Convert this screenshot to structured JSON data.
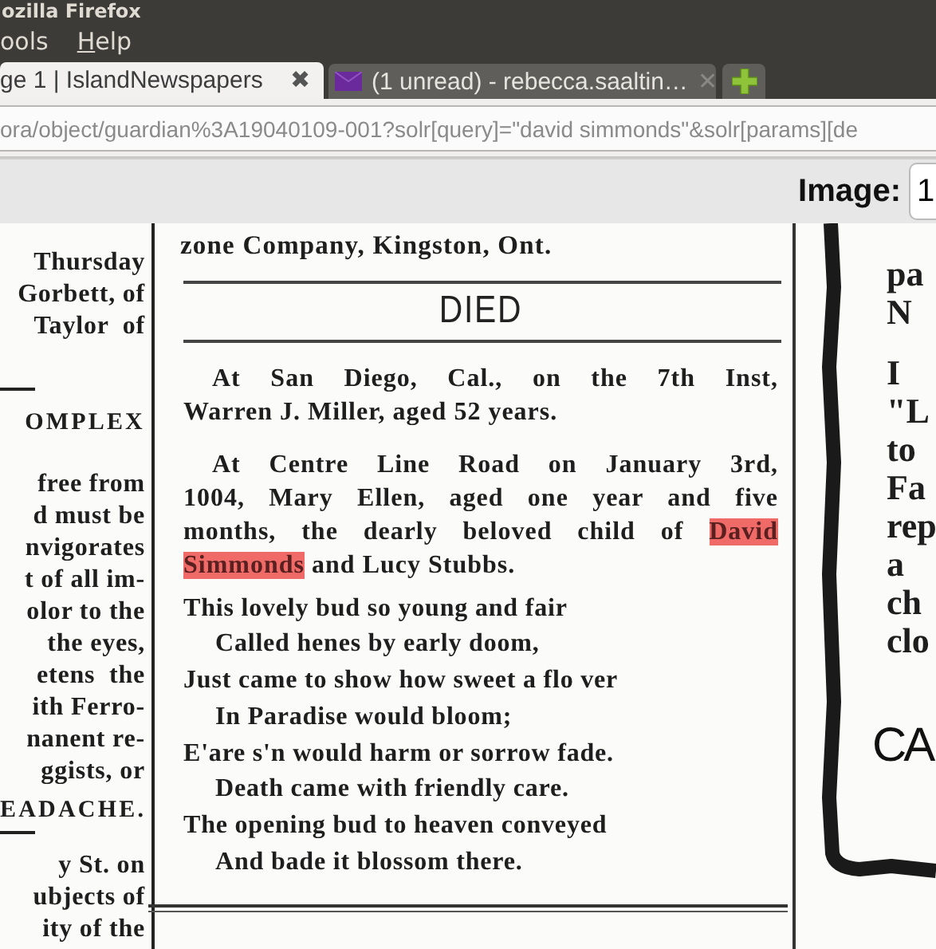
{
  "window": {
    "title": "ozilla Firefox"
  },
  "menu": [
    {
      "label": "ools",
      "underline_first": false
    },
    {
      "label": "Help",
      "underline_first": true
    }
  ],
  "tabs": [
    {
      "label": "ge 1 | IslandNewspapers",
      "selected": true,
      "kind": "page",
      "close": "✖"
    },
    {
      "label": "(1 unread) - rebecca.saaltin…",
      "selected": false,
      "kind": "mail",
      "close": "✕"
    }
  ],
  "address_bar": {
    "value": "ora/object/guardian%3A19040109-001?solr[query]=\"david simmonds\"&solr[params][de"
  },
  "viewer_toolbar": {
    "label": "Image:",
    "value": "1"
  },
  "newspaper": {
    "left_column": [
      {
        "kind": "line",
        "text": "Thursday"
      },
      {
        "kind": "line",
        "text": "Gorbett, of"
      },
      {
        "kind": "line",
        "text": "Taylor  of"
      },
      {
        "kind": "rule"
      },
      {
        "kind": "heading",
        "text": "OMPLEX"
      },
      {
        "kind": "gap_line",
        "text": "free from"
      },
      {
        "kind": "line",
        "text": "d must be"
      },
      {
        "kind": "line",
        "text": "nvigorates"
      },
      {
        "kind": "line",
        "text": "t of all im-"
      },
      {
        "kind": "line",
        "text": "olor to the"
      },
      {
        "kind": "line",
        "text": "the eyes,"
      },
      {
        "kind": "line",
        "text": "etens  the"
      },
      {
        "kind": "line",
        "text": "ith Ferro-"
      },
      {
        "kind": "line",
        "text": "nanent re-"
      },
      {
        "kind": "line",
        "text": "ggists, or"
      },
      {
        "kind": "heading",
        "text": "EADACHE."
      },
      {
        "kind": "rule"
      },
      {
        "kind": "line",
        "text": "y St. on"
      },
      {
        "kind": "line",
        "text": "ubjects of"
      },
      {
        "kind": "line",
        "text": "ity of the"
      }
    ],
    "middle_column": {
      "top_line": "zone Company, Kingston, Ont.",
      "heading": "DIED",
      "paragraphs": [
        {
          "lines": [
            [
              {
                "text": "At San Diego, Cal., on the 7th Inst,",
                "highlighted": false
              }
            ],
            [
              {
                "text": "Warren J. Miller, aged 52 years.",
                "highlighted": false
              }
            ]
          ]
        },
        {
          "lines": [
            [
              {
                "text": "At Centre Line Road on January 3rd,",
                "highlighted": false
              }
            ],
            [
              {
                "text": "1004, Mary Ellen, aged one year and five",
                "highlighted": false
              }
            ],
            [
              {
                "text": "months, the dearly beloved child of ",
                "highlighted": false
              },
              {
                "text": "David",
                "highlighted": true
              }
            ],
            [
              {
                "text": "Simmonds",
                "highlighted": true
              },
              {
                "text": " and Lucy Stubbs.",
                "highlighted": false
              }
            ]
          ]
        }
      ],
      "poem": [
        {
          "text": "This lovely bud so young and fair",
          "indented": false
        },
        {
          "text": "Called henes by early doom,",
          "indented": true
        },
        {
          "text": "Just came to show how sweet a flo ver",
          "indented": false
        },
        {
          "text": "In Paradise would bloom;",
          "indented": true
        },
        {
          "text": "E'are s'n would harm or sorrow fade.",
          "indented": false
        },
        {
          "text": "Death came with friendly care.",
          "indented": true
        },
        {
          "text": "The opening bud to heaven conveyed",
          "indented": false
        },
        {
          "text": "And bade it blossom there.",
          "indented": true
        }
      ]
    },
    "right_column": [
      {
        "kind": "line",
        "text": "pa"
      },
      {
        "kind": "line",
        "text": "N"
      },
      {
        "kind": "gap_line",
        "text": "I"
      },
      {
        "kind": "line",
        "text": "\"L"
      },
      {
        "kind": "line",
        "text": "to"
      },
      {
        "kind": "line",
        "text": "Fa"
      },
      {
        "kind": "line",
        "text": "rep"
      },
      {
        "kind": "line",
        "text": "a"
      },
      {
        "kind": "line",
        "text": "ch"
      },
      {
        "kind": "line",
        "text": "clo"
      },
      {
        "kind": "large",
        "text": "CA"
      }
    ]
  }
}
